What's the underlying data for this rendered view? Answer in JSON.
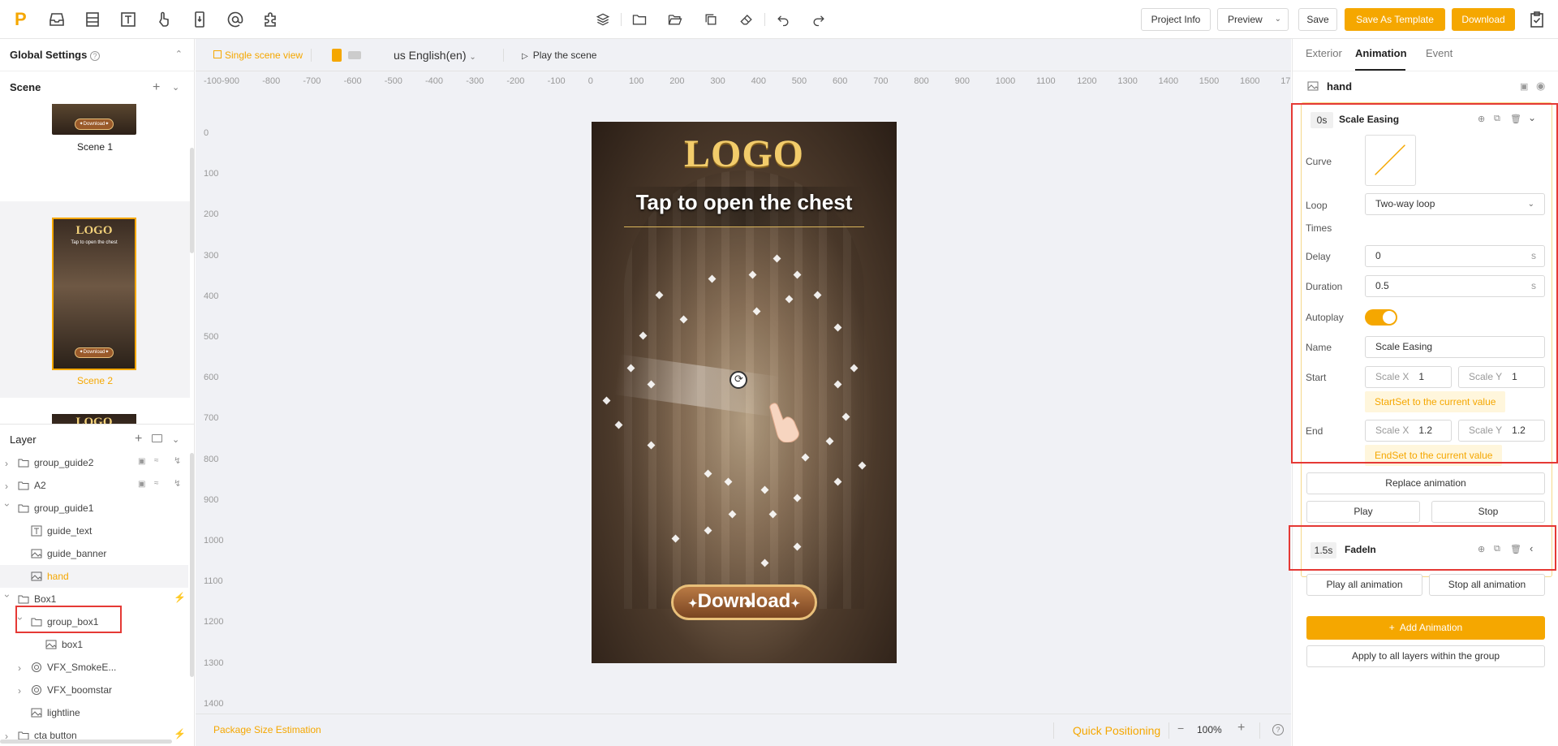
{
  "toolbar": {
    "logo": "P",
    "project_info": "Project Info",
    "preview": "Preview",
    "save": "Save",
    "save_as_template": "Save As Template",
    "download": "Download",
    "accent": "#f5a700"
  },
  "left": {
    "global_settings": "Global Settings",
    "scene_header": "Scene",
    "scenes": [
      {
        "name": "Scene 1",
        "selected": false
      },
      {
        "name": "Scene 2",
        "selected": true
      }
    ],
    "thumb_logo": "LOGO",
    "thumb_tap": "Tap to open the chest",
    "thumb_download": "Download",
    "layer_header": "Layer",
    "layers": [
      {
        "name": "group_guide2"
      },
      {
        "name": "A2"
      },
      {
        "name": "group_guide1"
      },
      {
        "name": "guide_text"
      },
      {
        "name": "guide_banner"
      },
      {
        "name": "hand",
        "selected": true
      },
      {
        "name": "Box1"
      },
      {
        "name": "group_box1"
      },
      {
        "name": "box1"
      },
      {
        "name": "VFX_SmokeE..."
      },
      {
        "name": "VFX_boomstar"
      },
      {
        "name": "lightline"
      },
      {
        "name": "cta button"
      }
    ]
  },
  "canvas": {
    "single_scene_view": "Single scene view",
    "language": "us English(en)",
    "play_scene": "Play the scene",
    "ruler_x": [
      "-100",
      "-900",
      "-800",
      "-700",
      "-600",
      "-500",
      "-400",
      "-300",
      "-200",
      "-100",
      "0",
      "100",
      "200",
      "300",
      "400",
      "500",
      "600",
      "700",
      "800",
      "900",
      "1000",
      "1100",
      "1200",
      "1300",
      "1400",
      "1500",
      "1600",
      "17"
    ],
    "ruler_y": [
      "0",
      "100",
      "200",
      "300",
      "400",
      "500",
      "600",
      "700",
      "800",
      "900",
      "1000",
      "1100",
      "1200",
      "1300",
      "1400"
    ],
    "logo_text": "LOGO",
    "tap_text": "Tap to open the chest",
    "download_text": "Download",
    "package_size": "Package Size Estimation",
    "quick_positioning": "Quick Positioning",
    "zoom": "100%"
  },
  "right": {
    "tabs": [
      "Exterior",
      "Animation",
      "Event"
    ],
    "active_tab": "Animation",
    "layer_name": "hand",
    "anim1": {
      "time": "0s",
      "name": "Scale Easing",
      "curve_label": "Curve",
      "loop_label": "Loop",
      "loop_value": "Two-way loop",
      "times_label": "Times",
      "delay_label": "Delay",
      "delay_value": "0",
      "duration_label": "Duration",
      "duration_value": "0.5",
      "unit": "s",
      "autoplay_label": "Autoplay",
      "autoplay": true,
      "name_label": "Name",
      "name_value": "Scale Easing",
      "start_label": "Start",
      "start_scale_x_label": "Scale X",
      "start_scale_x": "1",
      "start_scale_y_label": "Scale Y",
      "start_scale_y": "1",
      "start_set": "StartSet to the current value",
      "end_label": "End",
      "end_scale_x_label": "Scale X",
      "end_scale_x": "1.2",
      "end_scale_y_label": "Scale Y",
      "end_scale_y": "1.2",
      "end_set": "EndSet to the current value",
      "replace": "Replace animation",
      "play": "Play",
      "stop": "Stop"
    },
    "anim2": {
      "time": "1.5s",
      "name": "FadeIn"
    },
    "play_all": "Play all animation",
    "stop_all": "Stop all animation",
    "add_animation": "Add Animation",
    "apply_all": "Apply to all layers within the group"
  }
}
